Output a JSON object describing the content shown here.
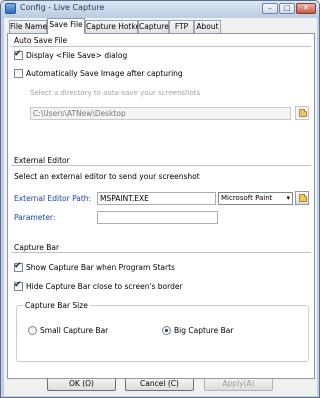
{
  "window": {
    "title": "Config - Live Capture",
    "controls": {
      "minimize": "–",
      "maximize": "□",
      "close": "✕"
    }
  },
  "tabs": [
    {
      "label": "File Name",
      "active": false
    },
    {
      "label": "Save File",
      "active": true
    },
    {
      "label": "Capture Hotkey",
      "active": false
    },
    {
      "label": "Capture",
      "active": false
    },
    {
      "label": "FTP",
      "active": false
    },
    {
      "label": "About",
      "active": false
    }
  ],
  "auto_save": {
    "title": "Auto Save File",
    "display_dialog": {
      "label": "Display <File Save> dialog",
      "checked": true
    },
    "auto_save_image": {
      "label": "Automatically Save Image after capturing",
      "checked": false
    },
    "directory_hint": "Select a directory to auto-save your screenshots",
    "directory_value": "C:\\Users\\ATNew\\Desktop"
  },
  "external_editor": {
    "title": "External Editor",
    "instruction": "Select an external editor to send your screenshot",
    "path_label": "External Editor Path:",
    "path_value": "MSPAINT.EXE",
    "editor_select": "Microsoft Paint",
    "parameter_label": "Parameter:",
    "parameter_value": ""
  },
  "capture_bar": {
    "title": "Capture Bar",
    "show_bar": {
      "label": "Show Capture Bar when Program Starts",
      "checked": true
    },
    "hide_bar": {
      "label": "Hide Capture Bar close to screen's border",
      "checked": true
    },
    "size_group_title": "Capture Bar Size",
    "small": {
      "label": "Small Capture Bar",
      "selected": false
    },
    "big": {
      "label": "Big Capture Bar",
      "selected": true
    }
  },
  "buttons": {
    "ok": "OK (O)",
    "cancel": "Cancel (C)",
    "apply": "Apply(A)"
  },
  "icons": {
    "checkmark": "✔",
    "dropdown": "▾"
  },
  "colors": {
    "link_label": "#1a3fa8",
    "window_frame": "#bfcfe3"
  }
}
